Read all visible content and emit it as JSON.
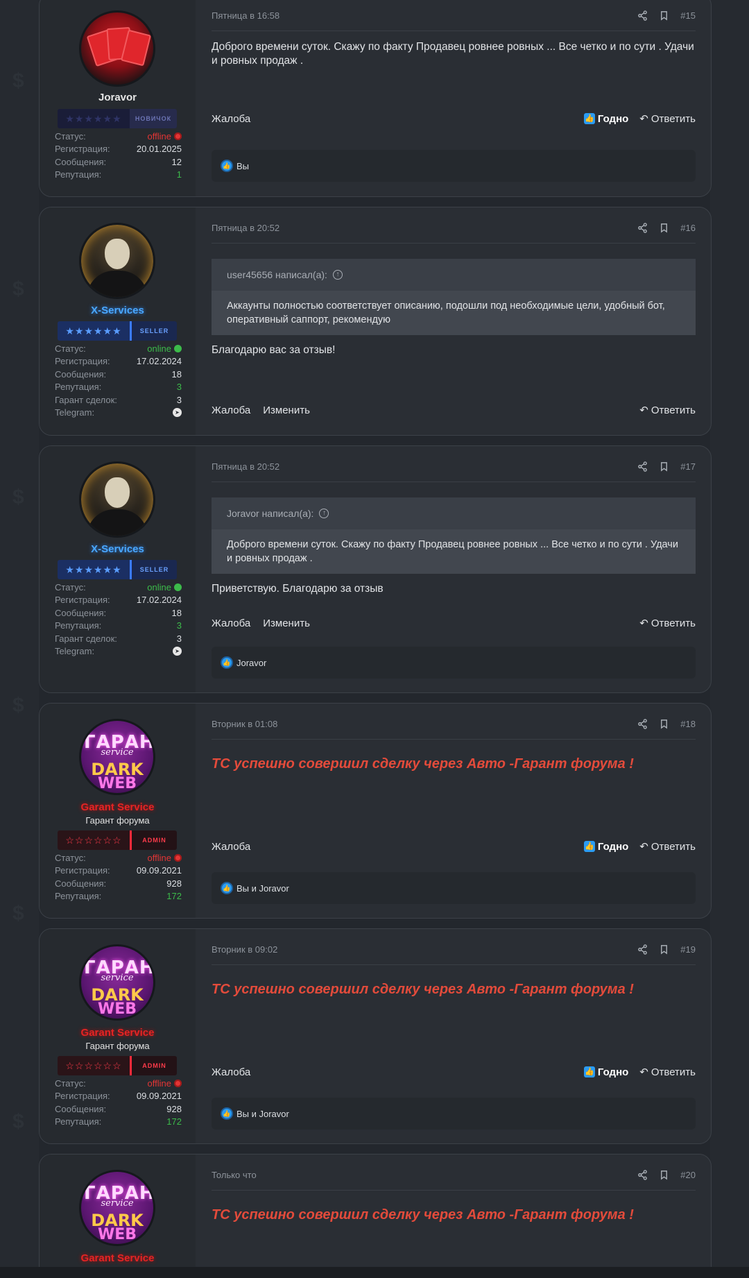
{
  "labels": {
    "status": "Статус:",
    "registration": "Регистрация:",
    "messages": "Сообщения:",
    "reputation": "Репутация:",
    "garant": "Гарант сделок:",
    "telegram": "Telegram:",
    "complaint": "Жалоба",
    "edit": "Изменить",
    "reply": "Ответить",
    "like": "Годно",
    "quote_arrow": "↑"
  },
  "posts": [
    {
      "date": "Пятница в 16:58",
      "num": "#15",
      "user": {
        "name": "Joravor",
        "rank": "НОВИЧОК",
        "status": "offline",
        "reg": "20.01.2025",
        "msgs": "12",
        "rep": "1"
      },
      "content": "Доброго времени суток. Скажу по факту Продавец ровнее ровных ... Все четко и по сути . Удачи и ровных продаж .",
      "likes": "Вы"
    },
    {
      "date": "Пятница в 20:52",
      "num": "#16",
      "user": {
        "name": "X-Services",
        "rank": "SELLER",
        "status": "online",
        "reg": "17.02.2024",
        "msgs": "18",
        "rep": "3",
        "garant": "3"
      },
      "quote_author": "user45656 написал(а):",
      "quote_text": "Аккаунты полностью соответствует описанию, подошли под необходимые цели, удобный бот, оперативный саппорт, рекомендую",
      "content": "Благодарю вас за отзыв!"
    },
    {
      "date": "Пятница в 20:52",
      "num": "#17",
      "user": {
        "name": "X-Services",
        "rank": "SELLER",
        "status": "online",
        "reg": "17.02.2024",
        "msgs": "18",
        "rep": "3",
        "garant": "3"
      },
      "quote_author": "Joravor написал(а):",
      "quote_text": "Доброго времени суток. Скажу по факту Продавец ровнее ровных ... Все четко и по сути . Удачи и ровных продаж .",
      "content": "Приветствую. Благодарю за отзыв",
      "likes": "Joravor"
    },
    {
      "date": "Вторник в 01:08",
      "num": "#18",
      "user": {
        "name": "Garant Service",
        "title": "Гарант форума",
        "rank": "ADMIN",
        "status": "offline",
        "reg": "09.09.2021",
        "msgs": "928",
        "rep": "172"
      },
      "content": "ТС успешно совершил сделку через Авто -Гарант форума !",
      "likes": "Вы и Joravor"
    },
    {
      "date": "Вторник в 09:02",
      "num": "#19",
      "user": {
        "name": "Garant Service",
        "title": "Гарант форума",
        "rank": "ADMIN",
        "status": "offline",
        "reg": "09.09.2021",
        "msgs": "928",
        "rep": "172"
      },
      "content": "ТС успешно совершил сделку через Авто -Гарант форума !",
      "likes": "Вы и Joravor"
    },
    {
      "date": "Только что",
      "num": "#20",
      "user": {
        "name": "Garant Service"
      },
      "content": "ТС успешно совершил сделку через Авто -Гарант форума !"
    }
  ],
  "avatar_text": {
    "line1": "ГАРАНТ",
    "line2": "service",
    "line3": "DARK",
    "line4": "WEB"
  },
  "colors": {
    "accent_blue": "#2b9cf2",
    "offline_red": "#e23535",
    "online_green": "#3cbb4a",
    "admin_red": "#e52424",
    "seller_blue": "#4aa8ff"
  }
}
